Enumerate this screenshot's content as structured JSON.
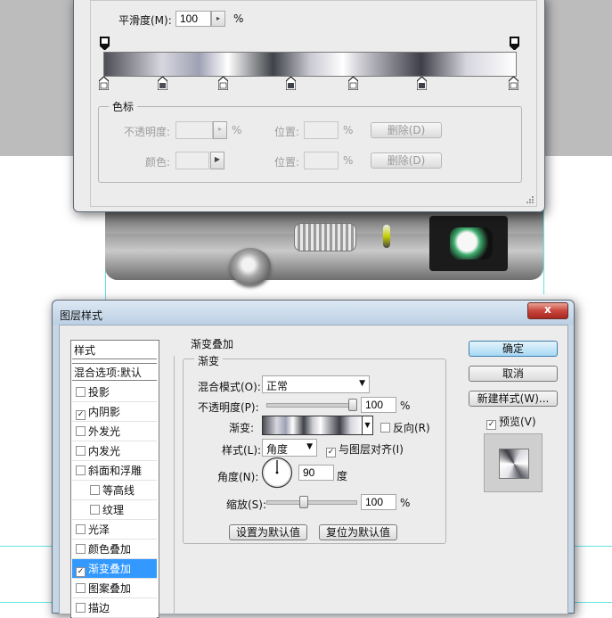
{
  "gradient_editor": {
    "smoothness_label": "平滑度(M):",
    "smoothness_value": "100",
    "smoothness_unit": "%",
    "stops_group_title": "色标",
    "opacity_label": "不透明度:",
    "opacity_unit": "%",
    "position_label_1": "位置:",
    "position_unit_1": "%",
    "delete_button_1": "删除(D)",
    "color_label": "颜色:",
    "position_label_2": "位置:",
    "position_unit_2": "%",
    "delete_button_2": "删除(D)"
  },
  "layer_style": {
    "title": "图层样式",
    "styles_header": "样式",
    "blend_options": "混合选项:默认",
    "items": [
      {
        "label": "投影",
        "checked": false,
        "indent": false
      },
      {
        "label": "内阴影",
        "checked": true,
        "indent": false
      },
      {
        "label": "外发光",
        "checked": false,
        "indent": false
      },
      {
        "label": "内发光",
        "checked": false,
        "indent": false
      },
      {
        "label": "斜面和浮雕",
        "checked": false,
        "indent": false
      },
      {
        "label": "等高线",
        "checked": false,
        "indent": true
      },
      {
        "label": "纹理",
        "checked": false,
        "indent": true
      },
      {
        "label": "光泽",
        "checked": false,
        "indent": false
      },
      {
        "label": "颜色叠加",
        "checked": false,
        "indent": false
      },
      {
        "label": "渐变叠加",
        "checked": true,
        "indent": false,
        "selected": true
      },
      {
        "label": "图案叠加",
        "checked": false,
        "indent": false
      },
      {
        "label": "描边",
        "checked": false,
        "indent": false
      }
    ],
    "section_title": "渐变叠加",
    "subsection_title": "渐变",
    "blend_mode_label": "混合模式(O):",
    "blend_mode_value": "正常",
    "opacity_label": "不透明度(P):",
    "opacity_value": "100",
    "opacity_unit": "%",
    "opacity_level": 1.0,
    "gradient_label": "渐变:",
    "reverse_label": "反向(R)",
    "reverse_checked": false,
    "style_label": "样式(L):",
    "style_value": "角度",
    "align_label": "与图层对齐(I)",
    "align_checked": true,
    "angle_label": "角度(N):",
    "angle_value": "90",
    "angle_unit": "度",
    "scale_label": "缩放(S):",
    "scale_value": "100",
    "scale_unit": "%",
    "scale_level": 0.4,
    "make_default_button": "设置为默认值",
    "reset_default_button": "复位为默认值",
    "ok_button": "确定",
    "cancel_button": "取消",
    "new_style_button": "新建样式(W)...",
    "preview_label": "预览(V)",
    "preview_checked": true,
    "close_glyph": "x"
  },
  "colors": {
    "selection_blue": "#3399ff",
    "guide_cyan": "#62e3e6",
    "title_bar": "#c6d6e6",
    "close_red": "#c9463d"
  },
  "icons": [
    "close-icon",
    "dropdown-arrow-icon",
    "check-icon",
    "angle-dial-icon",
    "color-stop-icon",
    "opacity-stop-icon",
    "resize-grip-icon"
  ]
}
